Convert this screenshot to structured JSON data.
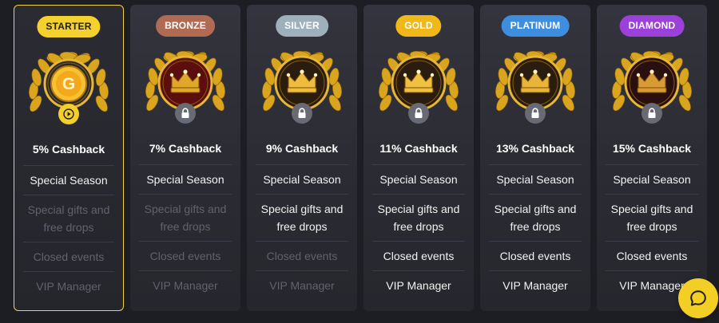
{
  "colors": {
    "page_background": "#1d1d24",
    "active_border": "#f2d33a",
    "feature_included": "#f2f2f2",
    "feature_excluded": "#62626c",
    "laurel_gold": "#d9a51f",
    "chat_button": "#f3cf26"
  },
  "tiers": [
    {
      "name": "STARTER",
      "pill_bg": "#f5d12d",
      "pill_fg": "#1d1d24",
      "badge_icon": "g-coin-icon",
      "status_icon": "play-icon",
      "active": true,
      "cashback": "5% Cashback",
      "features": [
        {
          "label": "Special Season",
          "included": true
        },
        {
          "label": "Special gifts and free drops",
          "included": false
        },
        {
          "label": "Closed events",
          "included": false
        },
        {
          "label": "VIP Manager",
          "included": false
        }
      ]
    },
    {
      "name": "BRONZE",
      "pill_bg": "#b26b53",
      "pill_fg": "#ffffff",
      "badge_icon": "crown-icon",
      "status_icon": "lock-icon",
      "active": false,
      "cashback": "7% Cashback",
      "features": [
        {
          "label": "Special Season",
          "included": true
        },
        {
          "label": "Special gifts and free drops",
          "included": false
        },
        {
          "label": "Closed events",
          "included": false
        },
        {
          "label": "VIP Manager",
          "included": false
        }
      ]
    },
    {
      "name": "SILVER",
      "pill_bg": "#9eb0bb",
      "pill_fg": "#ffffff",
      "badge_icon": "crown-icon",
      "status_icon": "lock-icon",
      "active": false,
      "cashback": "9% Cashback",
      "features": [
        {
          "label": "Special Season",
          "included": true
        },
        {
          "label": "Special gifts and free drops",
          "included": true
        },
        {
          "label": "Closed events",
          "included": false
        },
        {
          "label": "VIP Manager",
          "included": false
        }
      ]
    },
    {
      "name": "GOLD",
      "pill_bg": "#f1b81a",
      "pill_fg": "#ffffff",
      "badge_icon": "crown-icon",
      "status_icon": "lock-icon",
      "active": false,
      "cashback": "11% Cashback",
      "features": [
        {
          "label": "Special Season",
          "included": true
        },
        {
          "label": "Special gifts and free drops",
          "included": true
        },
        {
          "label": "Closed events",
          "included": true
        },
        {
          "label": "VIP Manager",
          "included": true
        }
      ]
    },
    {
      "name": "PLATINUM",
      "pill_bg": "#3e8ee0",
      "pill_fg": "#ffffff",
      "badge_icon": "crown-icon",
      "status_icon": "lock-icon",
      "active": false,
      "cashback": "13% Cashback",
      "features": [
        {
          "label": "Special Season",
          "included": true
        },
        {
          "label": "Special gifts and free drops",
          "included": true
        },
        {
          "label": "Closed events",
          "included": true
        },
        {
          "label": "VIP Manager",
          "included": true
        }
      ]
    },
    {
      "name": "DIAMOND",
      "pill_bg": "#9b41d9",
      "pill_fg": "#ffffff",
      "badge_icon": "crown-icon",
      "status_icon": "lock-icon",
      "active": false,
      "cashback": "15% Cashback",
      "features": [
        {
          "label": "Special Season",
          "included": true
        },
        {
          "label": "Special gifts and free drops",
          "included": true
        },
        {
          "label": "Closed events",
          "included": true
        },
        {
          "label": "VIP Manager",
          "included": true
        }
      ]
    }
  ],
  "chat_widget": {
    "icon": "chat-bubble-icon"
  }
}
